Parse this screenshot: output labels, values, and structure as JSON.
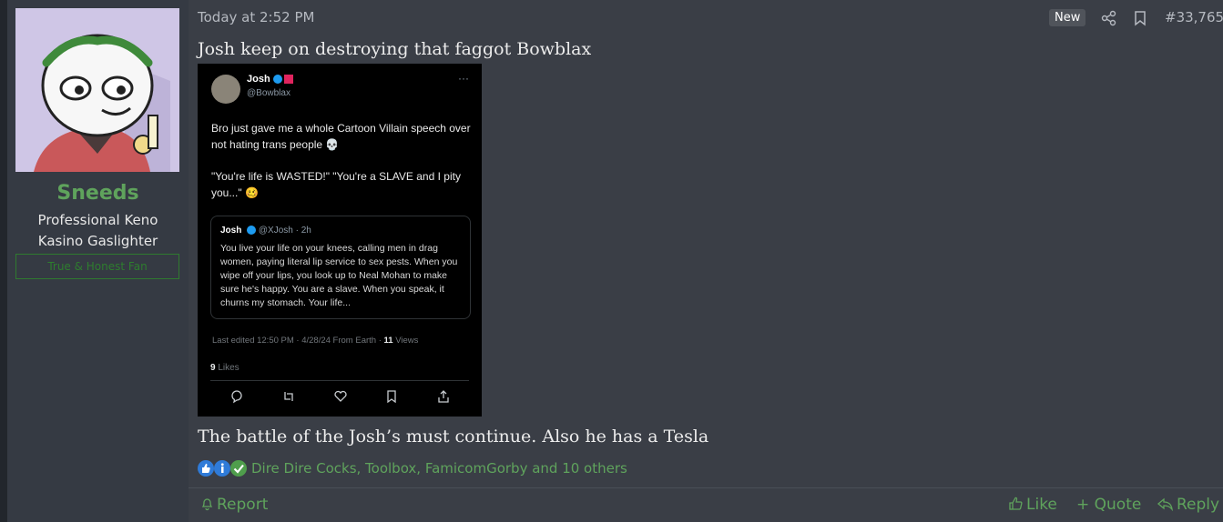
{
  "user": {
    "username": "Sneeds",
    "title_line1": "Professional Keno",
    "title_line2": "Kasino Gaslighter",
    "banner": "True & Honest Fan"
  },
  "post": {
    "timestamp": "Today at 2:52 PM",
    "badge": "New",
    "number": "#33,765",
    "message1": "Josh keep on destroying that faggot Bowblax",
    "message2": "The battle of the Josh’s must continue. Also he has a Tesla",
    "reactors": "Dire Dire Cocks, Toolbox, FamicomGorby and 10 others"
  },
  "tweet": {
    "name": "Josh",
    "handle": "@Bowblax",
    "more": "···",
    "text_p1": "Bro just gave me a whole Cartoon Villain speech over not hating trans people 💀",
    "text_p2": "\"You're life is WASTED!\" \"You're a SLAVE and I pity you...\" 🥴",
    "quote_name": "Josh",
    "quote_handle": "@XJosh · 2h",
    "quote_text": "You live your life on your knees, calling men in drag women, paying literal lip service to sex pests. When you wipe off your lips, you look up to Neal Mohan to make sure he's happy. You are a slave. When you speak, it churns my stomach. Your life...",
    "meta_prefix": "Last edited 12:50 PM · 4/28/24  From Earth · ",
    "views_count": "11",
    "views_label": " Views",
    "likes_count": "9",
    "likes_label": " Likes"
  },
  "footer": {
    "report": "Report",
    "like": "Like",
    "quote": "+ Quote",
    "reply": "Reply"
  },
  "colors": {
    "accent_green": "#5fa35c",
    "background": "#3a3e46",
    "sidebar": "#353a43"
  }
}
